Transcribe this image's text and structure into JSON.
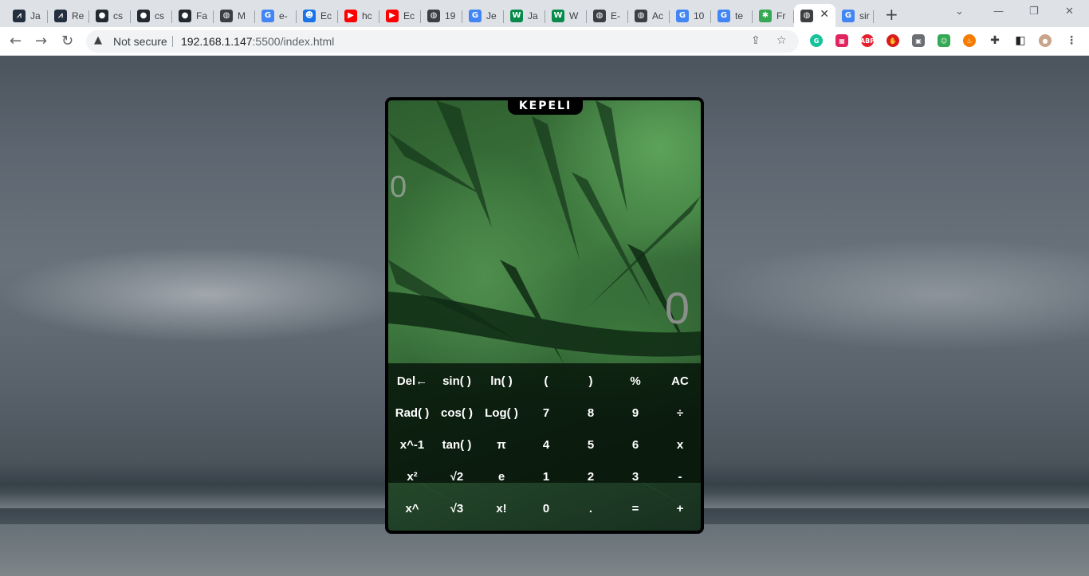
{
  "browser": {
    "tabs": [
      {
        "title": "Ja",
        "icon": "aws-icon",
        "color": "#232f3e"
      },
      {
        "title": "Re",
        "icon": "aws-icon",
        "color": "#232f3e"
      },
      {
        "title": "cs",
        "icon": "github-icon",
        "color": "#24292f"
      },
      {
        "title": "cs",
        "icon": "github-icon",
        "color": "#24292f"
      },
      {
        "title": "Fa",
        "icon": "github-icon",
        "color": "#24292f"
      },
      {
        "title": "M",
        "icon": "globe-icon",
        "color": "#3c4043"
      },
      {
        "title": "e-",
        "icon": "google-icon",
        "color": "#4285f4"
      },
      {
        "title": "Ec",
        "icon": "user-icon",
        "color": "#1a73e8"
      },
      {
        "title": "hc",
        "icon": "youtube-icon",
        "color": "#ff0000"
      },
      {
        "title": "Ec",
        "icon": "youtube-icon",
        "color": "#ff0000"
      },
      {
        "title": "19",
        "icon": "globe-icon",
        "color": "#3c4043"
      },
      {
        "title": "Je",
        "icon": "google-icon",
        "color": "#4285f4"
      },
      {
        "title": "Ja",
        "icon": "w-icon",
        "color": "#0a8a4a"
      },
      {
        "title": "W",
        "icon": "w-icon",
        "color": "#0a8a4a"
      },
      {
        "title": "E-",
        "icon": "globe-icon",
        "color": "#3c4043"
      },
      {
        "title": "Ac",
        "icon": "globe-icon",
        "color": "#3c4043"
      },
      {
        "title": "10",
        "icon": "google-icon",
        "color": "#4285f4"
      },
      {
        "title": "te",
        "icon": "google-icon",
        "color": "#4285f4"
      },
      {
        "title": "Fr",
        "icon": "puzzle-icon",
        "color": "#34a853"
      },
      {
        "title": "",
        "icon": "globe-icon",
        "color": "#3c4043"
      },
      {
        "title": "sir",
        "icon": "google-icon",
        "color": "#4285f4"
      }
    ],
    "security_label": "Not secure",
    "url_host": "192.168.1.147",
    "url_rest": ":5500/index.html"
  },
  "calculator": {
    "brand": "KEPELI",
    "history_display": "0",
    "main_display": "0",
    "keys": [
      [
        "Del←",
        "sin( )",
        "ln( )",
        "(",
        ")",
        "%",
        "AC"
      ],
      [
        "Rad( )",
        "cos( )",
        "Log( )",
        "7",
        "8",
        "9",
        "÷"
      ],
      [
        "x^-1",
        "tan( )",
        "π",
        "4",
        "5",
        "6",
        "x"
      ],
      [
        "x²",
        "√2",
        "e",
        "1",
        "2",
        "3",
        "-"
      ],
      [
        "x^",
        "√3",
        "x!",
        "0",
        ".",
        "=",
        "+"
      ]
    ]
  }
}
